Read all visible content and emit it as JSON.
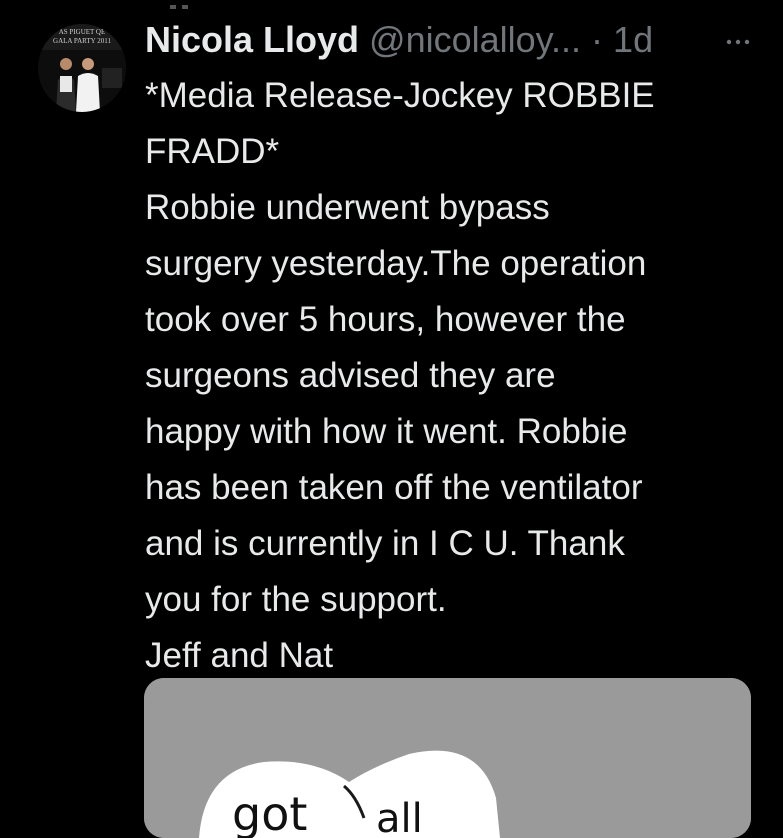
{
  "tweet": {
    "author_name": "Nicola Lloyd",
    "handle": "@nicolalloy...",
    "separator": "·",
    "time": "1d",
    "more_icon": "more-horizontal-icon",
    "lines": [
      "*Media Release-Jockey ROBBIE",
      "FRADD*",
      "Robbie underwent bypass",
      "surgery yesterday.The operation",
      "took over 5 hours, however the",
      "surgeons advised they are",
      "happy with how it went. Robbie",
      "has been taken off the ventilator",
      "and is currently in I C U. Thank",
      "you for the support.",
      "Jeff and Nat"
    ]
  },
  "avatar": {
    "banner_line1": "AS PIGUET QE",
    "banner_line2": "GALA PARTY 2011"
  },
  "media": {
    "image_text_left": "got",
    "image_text_right": "all"
  },
  "colors": {
    "background": "#000000",
    "text_primary": "#e7e9ea",
    "text_secondary": "#71767b",
    "media_background": "#9a9a9a"
  }
}
